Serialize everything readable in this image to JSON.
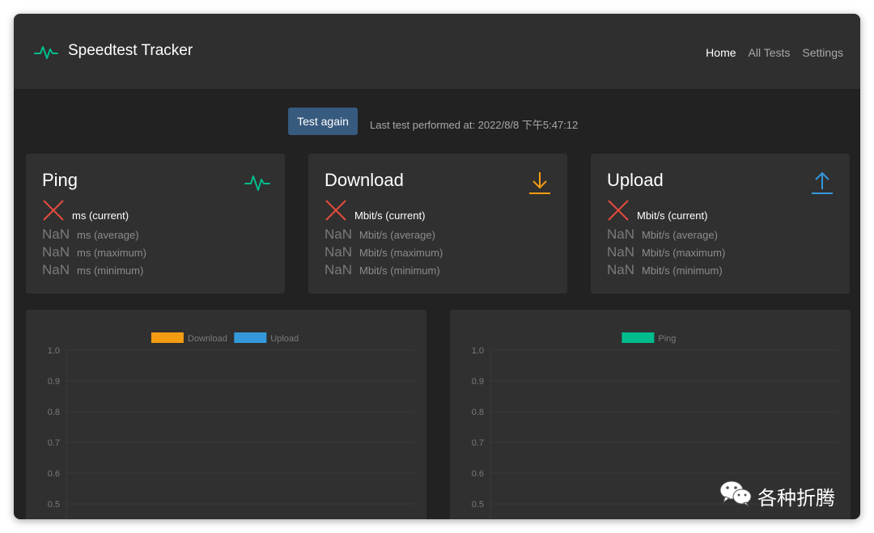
{
  "app": {
    "title": "Speedtest Tracker"
  },
  "nav": {
    "items": [
      {
        "label": "Home",
        "active": true
      },
      {
        "label": "All Tests",
        "active": false
      },
      {
        "label": "Settings",
        "active": false
      }
    ]
  },
  "toolbar": {
    "test_again_label": "Test again",
    "last_test": "Last test performed at: 2022/8/8 下午5:47:12"
  },
  "cards": {
    "ping": {
      "title": "Ping",
      "icon": "pulse-icon",
      "icon_color": "#00bc8c",
      "current_unit": "ms (current)",
      "stats": [
        {
          "value": "NaN",
          "unit": "ms (average)"
        },
        {
          "value": "NaN",
          "unit": "ms (maximum)"
        },
        {
          "value": "NaN",
          "unit": "ms (minimum)"
        }
      ]
    },
    "download": {
      "title": "Download",
      "icon": "download-arrow-icon",
      "icon_color": "#f39c12",
      "current_unit": "Mbit/s (current)",
      "stats": [
        {
          "value": "NaN",
          "unit": "Mbit/s (average)"
        },
        {
          "value": "NaN",
          "unit": "Mbit/s (maximum)"
        },
        {
          "value": "NaN",
          "unit": "Mbit/s (minimum)"
        }
      ]
    },
    "upload": {
      "title": "Upload",
      "icon": "upload-arrow-icon",
      "icon_color": "#3498db",
      "current_unit": "Mbit/s (current)",
      "stats": [
        {
          "value": "NaN",
          "unit": "Mbit/s (average)"
        },
        {
          "value": "NaN",
          "unit": "Mbit/s (maximum)"
        },
        {
          "value": "NaN",
          "unit": "Mbit/s (minimum)"
        }
      ]
    }
  },
  "colors": {
    "error_x": "#e74c3c",
    "download": "#f39c12",
    "upload": "#3498db",
    "ping": "#00bc8c",
    "button": "#375a7f"
  },
  "chart_data": [
    {
      "type": "line",
      "series": [
        {
          "name": "Download",
          "color": "#f39c12",
          "values": []
        },
        {
          "name": "Upload",
          "color": "#3498db",
          "values": []
        }
      ],
      "yticks": [
        "1.0",
        "0.9",
        "0.8",
        "0.7",
        "0.6",
        "0.5"
      ],
      "ylim": [
        0.5,
        1.0
      ],
      "legend": "top-center",
      "grid": true
    },
    {
      "type": "line",
      "series": [
        {
          "name": "Ping",
          "color": "#00bc8c",
          "values": []
        }
      ],
      "yticks": [
        "1.0",
        "0.9",
        "0.8",
        "0.7",
        "0.6",
        "0.5"
      ],
      "ylim": [
        0.5,
        1.0
      ],
      "legend": "top-center",
      "grid": true
    }
  ],
  "watermark": {
    "text": "各种折腾",
    "icon": "wechat-icon"
  }
}
